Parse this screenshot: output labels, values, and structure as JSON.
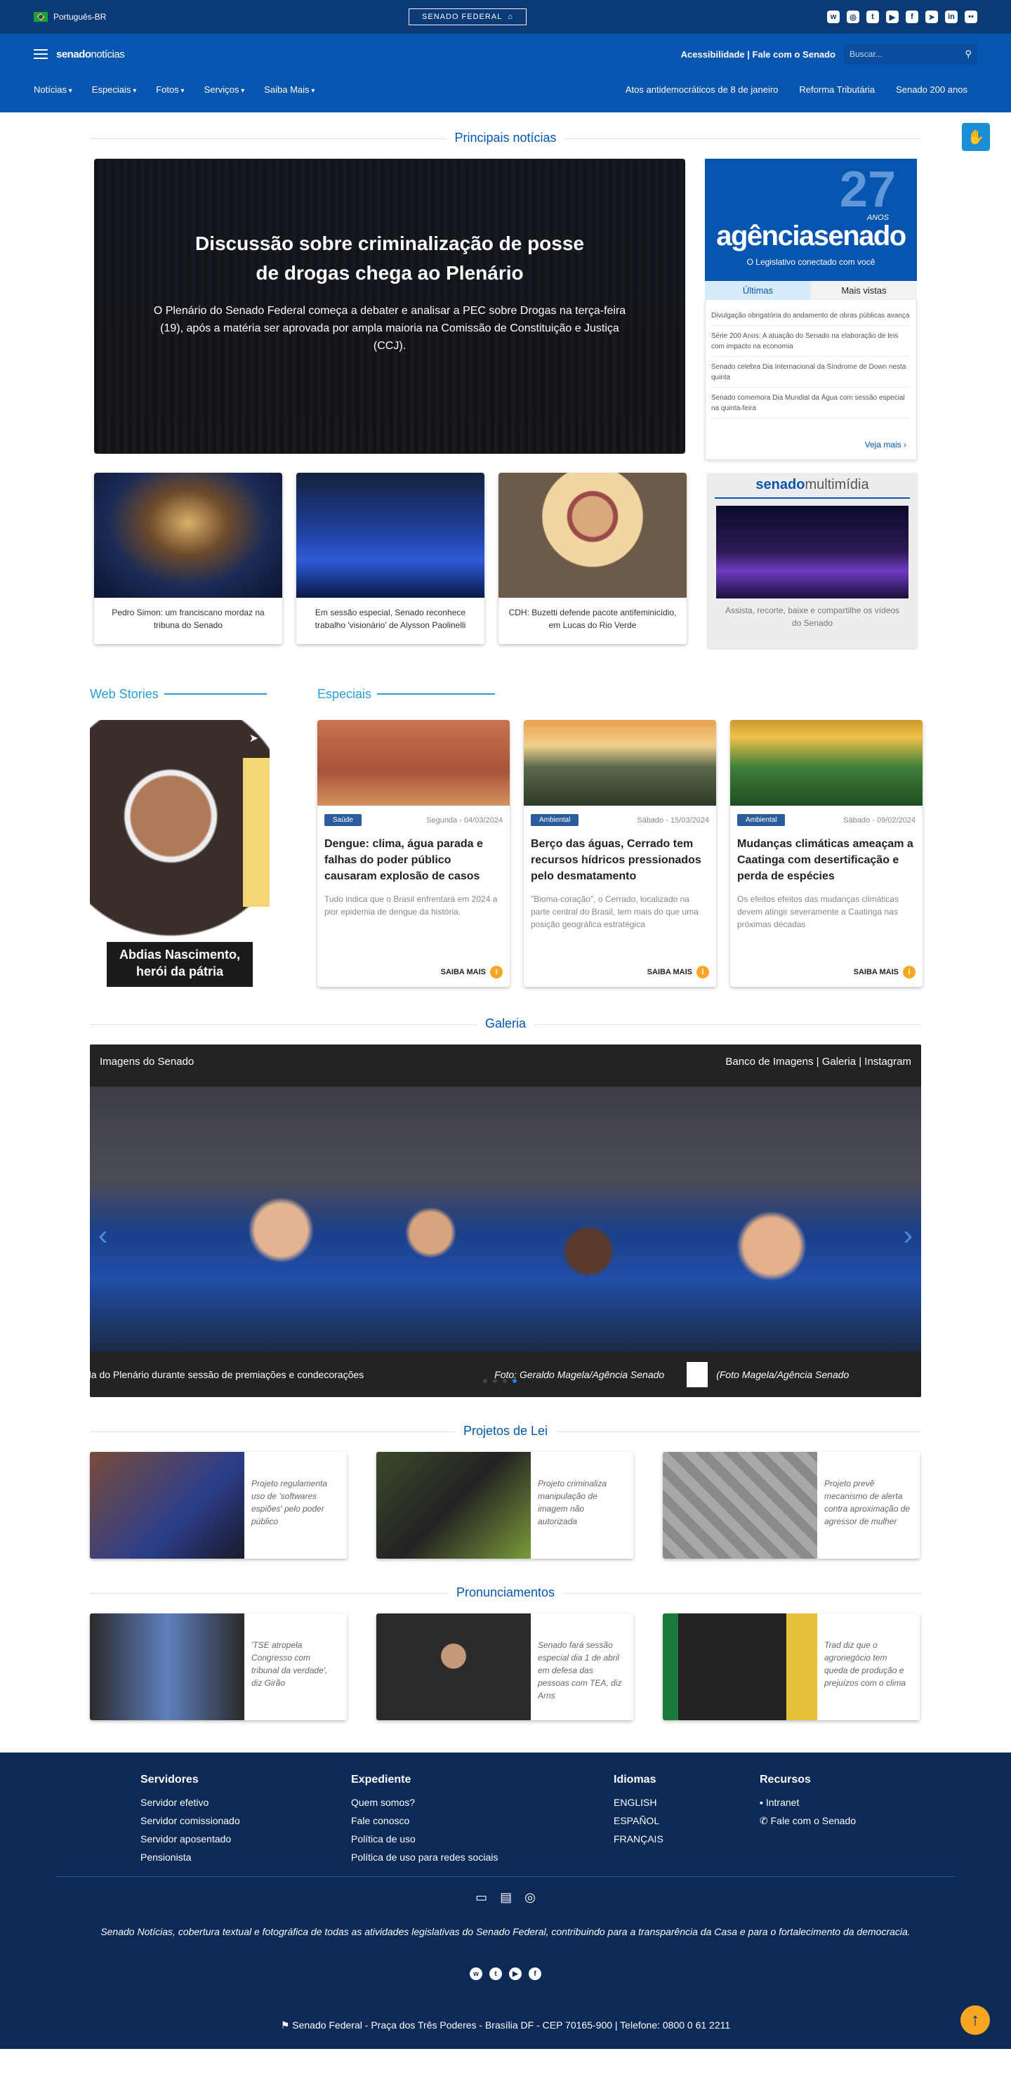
{
  "topbar": {
    "language": "Português-BR",
    "logo": "SENADO FEDERAL",
    "social_icons": [
      "whatsapp-icon",
      "instagram-icon",
      "twitter-icon",
      "youtube-icon",
      "facebook-icon",
      "telegram-icon",
      "linkedin-icon",
      "flickr-icon"
    ]
  },
  "header": {
    "brand_prefix": "senado",
    "brand_suffix": "notícias",
    "links": "Acessibilidade | Fale com o Senado",
    "search_placeholder": "Buscar...",
    "menu": [
      "Notícias",
      "Especiais",
      "Fotos",
      "Serviços",
      "Saiba Mais"
    ],
    "quick_links": [
      "Atos antidemocráticos de 8 de janeiro",
      "Reforma Tributária",
      "Senado 200 anos"
    ]
  },
  "principais": {
    "title": "Principais notícias",
    "hero": {
      "headline": "Discussão sobre criminalização de posse de drogas chega ao Plenário",
      "summary": "O Plenário do Senado Federal começa a debater e analisar a PEC sobre Drogas na terça-feira (19), após a matéria ser aprovada por ampla maioria na Comissão de Constituição e Justiça (CCJ)."
    },
    "agencia": {
      "number": "27",
      "anos": "ANOS",
      "name": "agênciasenado",
      "tagline": "O Legislativo conectado com você",
      "tab_active": "Últimas",
      "tab_other": "Mais vistas",
      "items": [
        "Divulgação obrigatória do andamento de obras públicas avança",
        "Série 200 Anos: A atuação do Senado na elaboração de leis com impacto na economia",
        "Senado celebra Dia Internacional da Síndrome de Down nesta quinta",
        "Senado comemora Dia Mundial da Água com sessão especial na quinta-feira"
      ],
      "see_more": "Veja mais ›"
    },
    "cards": [
      "Pedro Simon: um franciscano mordaz na tribuna do Senado",
      "Em sessão especial, Senado reconhece trabalho 'visionário' de Alysson Paolinelli",
      "CDH: Buzetti defende pacote antifeminicídio, em Lucas do Rio Verde"
    ],
    "multimidia": {
      "brand_prefix": "senado",
      "brand_suffix": "multimídia",
      "caption": "Assista, recorte, baixe e compartilhe os vídeos do Senado"
    }
  },
  "web_stories": {
    "title": "Web Stories",
    "caption": "Abdias Nascimento, herói da pátria"
  },
  "especiais": {
    "title": "Especiais",
    "cards": [
      {
        "badge": "Saúde",
        "date": "Segunda - 04/03/2024",
        "title": "Dengue: clima, água parada e falhas do poder público causaram explosão de casos",
        "summary": "Tudo indica que o Brasil enfrentará em 2024 a pior epidemia de dengue da história."
      },
      {
        "badge": "Ambiental",
        "date": "Sábado - 15/03/2024",
        "title": "Berço das águas, Cerrado tem recursos hídricos pressionados pelo desmatamento",
        "summary": "\"Bioma-coração\", o Cerrado, localizado na parte central do Brasil, tem mais do que uma posição geográfica estratégica"
      },
      {
        "badge": "Ambiental",
        "date": "Sábado - 09/02/2024",
        "title": "Mudanças climáticas ameaçam a Caatinga com desertificação e perda de espécies",
        "summary": "Os efeitos efeitos das mudanças climáticas devem atingir severamente a Caatinga nas próximas décadas"
      }
    ],
    "saiba_mais": "SAIBA MAIS"
  },
  "galeria": {
    "title": "Galeria",
    "left_label": "Imagens do Senado",
    "right_links": "Banco de Imagens | Galeria | Instagram",
    "caption_text": "da do Plenário durante sessão de premiações e condecorações",
    "credit": "Foto: Geraldo Magela/Agência Senado",
    "credit_next": "(Foto Magela/Agência Senado"
  },
  "projetos": {
    "title": "Projetos de Lei",
    "items": [
      "Projeto regulamenta uso de 'softwares espiões' pelo poder público",
      "Projeto criminaliza manipulação de imagem não autorizada",
      "Projeto prevê mecanismo de alerta contra aproximação de agressor de mulher"
    ]
  },
  "pronunciamentos": {
    "title": "Pronunciamentos",
    "items": [
      "'TSE atropela Congresso com tribunal da verdade', diz Girão",
      "Senado fará sessão especial dia 1 de abril em defesa das pessoas com TEA, diz Arns",
      "Trad diz que o agronegócio tem queda de produção e prejuízos com o clima"
    ]
  },
  "footer": {
    "columns": [
      {
        "title": "Servidores",
        "items": [
          "Servidor efetivo",
          "Servidor comissionado",
          "Servidor aposentado",
          "Pensionista"
        ]
      },
      {
        "title": "Expediente",
        "items": [
          "Quem somos?",
          "Fale conosco",
          "Política de uso",
          "Política de uso para redes sociais"
        ]
      },
      {
        "title": "Idiomas",
        "items": [
          "ENGLISH",
          "ESPAÑOL",
          "FRANÇAIS"
        ]
      },
      {
        "title": "Recursos",
        "items": [
          "Intranet",
          "Fale com o Senado"
        ]
      }
    ],
    "description": "Senado Notícias, cobertura textual e fotográfica de todas as atividades legislativas do Senado Federal, contribuindo para a transparência da Casa e para o fortalecimento da democracia.",
    "address": "Senado Federal - Praça dos Três Poderes - Brasília DF - CEP 70165-900 | Telefone: 0800 0 61 2211"
  }
}
